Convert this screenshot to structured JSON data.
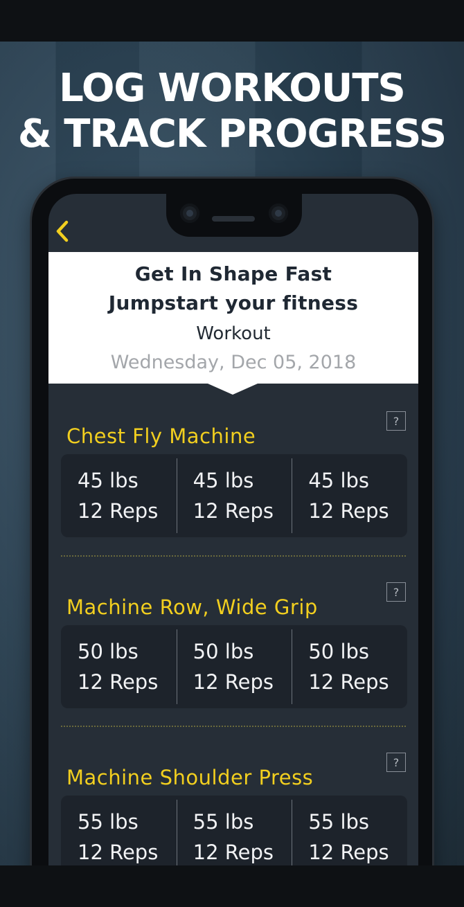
{
  "headline": {
    "line1": "LOG WORKOUTS",
    "line2": "& TRACK PROGRESS"
  },
  "colors": {
    "accent": "#f2cf1f",
    "screen_bg": "#262e37",
    "set_card_bg": "#1d232b"
  },
  "header": {
    "back_icon": "chevron-left-icon",
    "program_title": "Get In Shape Fast",
    "program_subtitle": "Jumpstart your fitness",
    "workout_label": "Workout",
    "date": "Wednesday, Dec 05, 2018"
  },
  "exercises": [
    {
      "name": "Chest Fly Machine",
      "help_label": "?",
      "sets": [
        {
          "weight": "45 lbs",
          "reps": "12 Reps"
        },
        {
          "weight": "45 lbs",
          "reps": "12 Reps"
        },
        {
          "weight": "45 lbs",
          "reps": "12 Reps"
        }
      ]
    },
    {
      "name": "Machine Row, Wide Grip",
      "help_label": "?",
      "sets": [
        {
          "weight": "50 lbs",
          "reps": "12 Reps"
        },
        {
          "weight": "50 lbs",
          "reps": "12 Reps"
        },
        {
          "weight": "50 lbs",
          "reps": "12 Reps"
        }
      ]
    },
    {
      "name": "Machine Shoulder Press",
      "help_label": "?",
      "sets": [
        {
          "weight": "55 lbs",
          "reps": "12 Reps"
        },
        {
          "weight": "55 lbs",
          "reps": "12 Reps"
        },
        {
          "weight": "55 lbs",
          "reps": "12 Reps"
        }
      ]
    }
  ]
}
